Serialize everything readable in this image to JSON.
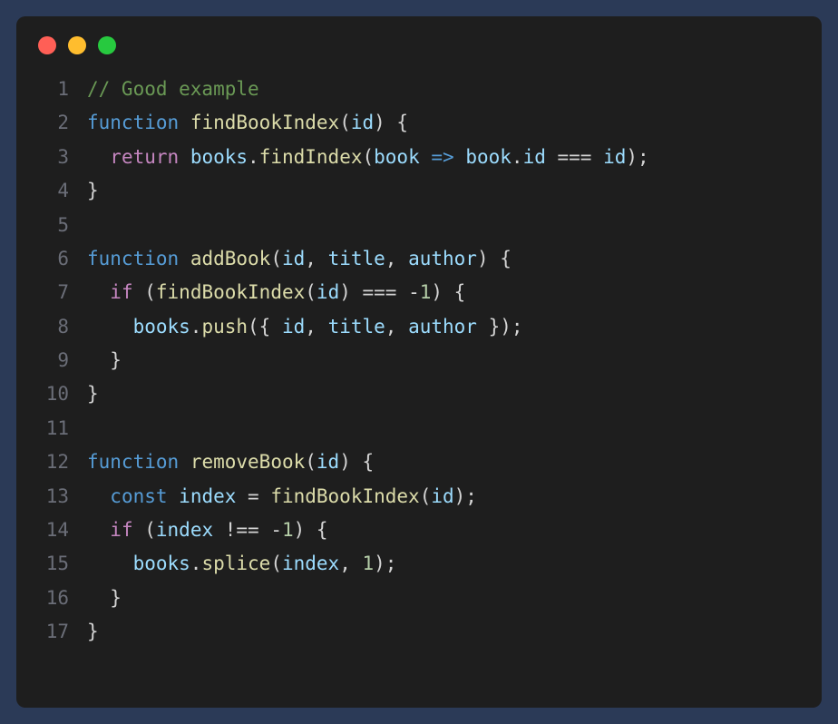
{
  "lines": [
    {
      "n": "1",
      "tokens": [
        {
          "t": "// Good example",
          "c": "tok-comment"
        }
      ]
    },
    {
      "n": "2",
      "tokens": [
        {
          "t": "function",
          "c": "tok-keyword"
        },
        {
          "t": " ",
          "c": ""
        },
        {
          "t": "findBookIndex",
          "c": "tok-fn"
        },
        {
          "t": "(",
          "c": "tok-punc"
        },
        {
          "t": "id",
          "c": "tok-param"
        },
        {
          "t": ") {",
          "c": "tok-punc"
        }
      ]
    },
    {
      "n": "3",
      "tokens": [
        {
          "t": "  ",
          "c": ""
        },
        {
          "t": "return",
          "c": "tok-ctrl"
        },
        {
          "t": " ",
          "c": ""
        },
        {
          "t": "books",
          "c": "tok-var"
        },
        {
          "t": ".",
          "c": "tok-punc"
        },
        {
          "t": "findIndex",
          "c": "tok-fn"
        },
        {
          "t": "(",
          "c": "tok-punc"
        },
        {
          "t": "book",
          "c": "tok-param"
        },
        {
          "t": " ",
          "c": ""
        },
        {
          "t": "=>",
          "c": "tok-keyword"
        },
        {
          "t": " ",
          "c": ""
        },
        {
          "t": "book",
          "c": "tok-var"
        },
        {
          "t": ".",
          "c": "tok-punc"
        },
        {
          "t": "id",
          "c": "tok-var"
        },
        {
          "t": " === ",
          "c": "tok-op"
        },
        {
          "t": "id",
          "c": "tok-var"
        },
        {
          "t": ");",
          "c": "tok-punc"
        }
      ]
    },
    {
      "n": "4",
      "tokens": [
        {
          "t": "}",
          "c": "tok-punc"
        }
      ]
    },
    {
      "n": "5",
      "tokens": [
        {
          "t": "",
          "c": ""
        }
      ]
    },
    {
      "n": "6",
      "tokens": [
        {
          "t": "function",
          "c": "tok-keyword"
        },
        {
          "t": " ",
          "c": ""
        },
        {
          "t": "addBook",
          "c": "tok-fn"
        },
        {
          "t": "(",
          "c": "tok-punc"
        },
        {
          "t": "id",
          "c": "tok-param"
        },
        {
          "t": ", ",
          "c": "tok-punc"
        },
        {
          "t": "title",
          "c": "tok-param"
        },
        {
          "t": ", ",
          "c": "tok-punc"
        },
        {
          "t": "author",
          "c": "tok-param"
        },
        {
          "t": ") {",
          "c": "tok-punc"
        }
      ]
    },
    {
      "n": "7",
      "tokens": [
        {
          "t": "  ",
          "c": ""
        },
        {
          "t": "if",
          "c": "tok-ctrl"
        },
        {
          "t": " (",
          "c": "tok-punc"
        },
        {
          "t": "findBookIndex",
          "c": "tok-fn"
        },
        {
          "t": "(",
          "c": "tok-punc"
        },
        {
          "t": "id",
          "c": "tok-var"
        },
        {
          "t": ") === ",
          "c": "tok-op"
        },
        {
          "t": "-",
          "c": "tok-op"
        },
        {
          "t": "1",
          "c": "tok-num"
        },
        {
          "t": ") {",
          "c": "tok-punc"
        }
      ]
    },
    {
      "n": "8",
      "tokens": [
        {
          "t": "    ",
          "c": ""
        },
        {
          "t": "books",
          "c": "tok-var"
        },
        {
          "t": ".",
          "c": "tok-punc"
        },
        {
          "t": "push",
          "c": "tok-fn"
        },
        {
          "t": "({ ",
          "c": "tok-punc"
        },
        {
          "t": "id",
          "c": "tok-var"
        },
        {
          "t": ", ",
          "c": "tok-punc"
        },
        {
          "t": "title",
          "c": "tok-var"
        },
        {
          "t": ", ",
          "c": "tok-punc"
        },
        {
          "t": "author",
          "c": "tok-var"
        },
        {
          "t": " });",
          "c": "tok-punc"
        }
      ]
    },
    {
      "n": "9",
      "tokens": [
        {
          "t": "  }",
          "c": "tok-punc"
        }
      ]
    },
    {
      "n": "10",
      "tokens": [
        {
          "t": "}",
          "c": "tok-punc"
        }
      ]
    },
    {
      "n": "11",
      "tokens": [
        {
          "t": "",
          "c": ""
        }
      ]
    },
    {
      "n": "12",
      "tokens": [
        {
          "t": "function",
          "c": "tok-keyword"
        },
        {
          "t": " ",
          "c": ""
        },
        {
          "t": "removeBook",
          "c": "tok-fn"
        },
        {
          "t": "(",
          "c": "tok-punc"
        },
        {
          "t": "id",
          "c": "tok-param"
        },
        {
          "t": ") {",
          "c": "tok-punc"
        }
      ]
    },
    {
      "n": "13",
      "tokens": [
        {
          "t": "  ",
          "c": ""
        },
        {
          "t": "const",
          "c": "tok-keyword"
        },
        {
          "t": " ",
          "c": ""
        },
        {
          "t": "index",
          "c": "tok-var"
        },
        {
          "t": " = ",
          "c": "tok-op"
        },
        {
          "t": "findBookIndex",
          "c": "tok-fn"
        },
        {
          "t": "(",
          "c": "tok-punc"
        },
        {
          "t": "id",
          "c": "tok-var"
        },
        {
          "t": ");",
          "c": "tok-punc"
        }
      ]
    },
    {
      "n": "14",
      "tokens": [
        {
          "t": "  ",
          "c": ""
        },
        {
          "t": "if",
          "c": "tok-ctrl"
        },
        {
          "t": " (",
          "c": "tok-punc"
        },
        {
          "t": "index",
          "c": "tok-var"
        },
        {
          "t": " !== ",
          "c": "tok-op"
        },
        {
          "t": "-",
          "c": "tok-op"
        },
        {
          "t": "1",
          "c": "tok-num"
        },
        {
          "t": ") {",
          "c": "tok-punc"
        }
      ]
    },
    {
      "n": "15",
      "tokens": [
        {
          "t": "    ",
          "c": ""
        },
        {
          "t": "books",
          "c": "tok-var"
        },
        {
          "t": ".",
          "c": "tok-punc"
        },
        {
          "t": "splice",
          "c": "tok-fn"
        },
        {
          "t": "(",
          "c": "tok-punc"
        },
        {
          "t": "index",
          "c": "tok-var"
        },
        {
          "t": ", ",
          "c": "tok-punc"
        },
        {
          "t": "1",
          "c": "tok-num"
        },
        {
          "t": ");",
          "c": "tok-punc"
        }
      ]
    },
    {
      "n": "16",
      "tokens": [
        {
          "t": "  }",
          "c": "tok-punc"
        }
      ]
    },
    {
      "n": "17",
      "tokens": [
        {
          "t": "}",
          "c": "tok-punc"
        }
      ]
    }
  ]
}
